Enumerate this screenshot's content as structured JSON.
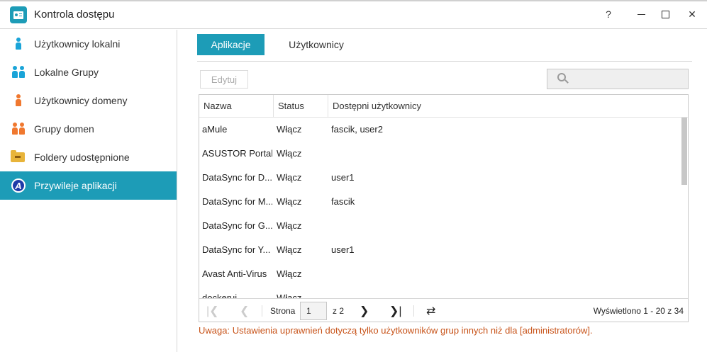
{
  "window": {
    "title": "Kontrola dostępu",
    "controls": {
      "help": "?",
      "minimize": "",
      "maximize": "",
      "close": "✕"
    }
  },
  "sidebar": {
    "items": [
      {
        "label": "Użytkownicy lokalni",
        "icon": "local-user-icon",
        "active": false
      },
      {
        "label": "Lokalne Grupy",
        "icon": "local-group-icon",
        "active": false
      },
      {
        "label": "Użytkownicy domeny",
        "icon": "domain-user-icon",
        "active": false
      },
      {
        "label": "Grupy domen",
        "icon": "domain-group-icon",
        "active": false
      },
      {
        "label": "Foldery udostępnione",
        "icon": "shared-folder-icon",
        "active": false
      },
      {
        "label": "Przywileje aplikacji",
        "icon": "app-privilege-icon",
        "active": true
      }
    ]
  },
  "tabs": [
    {
      "label": "Aplikacje",
      "active": true
    },
    {
      "label": "Użytkownicy",
      "active": false
    }
  ],
  "toolbar": {
    "edit_label": "Edytuj",
    "search_placeholder": ""
  },
  "table": {
    "columns": [
      "Nazwa",
      "Status",
      "Dostępni użytkownicy"
    ],
    "rows": [
      {
        "name": "aMule",
        "status": "Włącz",
        "users": "fascik, user2"
      },
      {
        "name": "ASUSTOR Portal",
        "status": "Włącz",
        "users": ""
      },
      {
        "name": "DataSync for D...",
        "status": "Włącz",
        "users": "user1"
      },
      {
        "name": "DataSync for M...",
        "status": "Włącz",
        "users": "fascik"
      },
      {
        "name": "DataSync for G...",
        "status": "Włącz",
        "users": ""
      },
      {
        "name": "DataSync for Y...",
        "status": "Włącz",
        "users": "user1"
      },
      {
        "name": "Avast Anti-Virus",
        "status": "Włącz",
        "users": ""
      },
      {
        "name": "dockerui",
        "status": "Włącz",
        "users": ""
      }
    ]
  },
  "pager": {
    "page_label": "Strona",
    "page_value": "1",
    "of_label": "z 2",
    "info": "Wyświetlono 1 - 20 z 34",
    "first": "|❮",
    "prev": "❮",
    "next": "❯",
    "last": "❯|",
    "refresh": "⇄"
  },
  "warning": "Uwaga: Ustawienia uprawnień dotyczą tylko użytkowników grup innych niż dla [administratorów].",
  "colors": {
    "accent": "#1d9cb7",
    "warning": "#c8541a"
  }
}
